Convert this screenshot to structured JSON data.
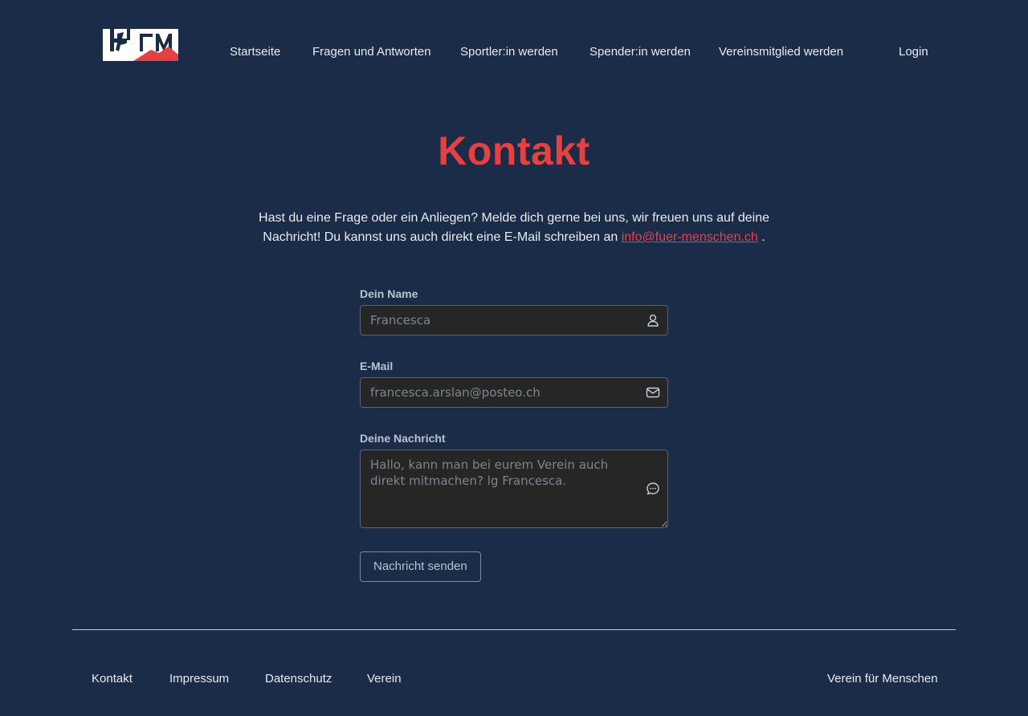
{
  "header": {
    "logo_alt": "HFM",
    "nav": [
      {
        "label": "Startseite"
      },
      {
        "label": "Fragen und Antworten"
      },
      {
        "label": "Sportler:in werden"
      },
      {
        "label": "Spender:in werden"
      },
      {
        "label": "Vereinsmitglied werden"
      }
    ],
    "login_label": "Login"
  },
  "main": {
    "title": "Kontakt",
    "intro_text": "Hast du eine Frage oder ein Anliegen? Melde dich gerne bei uns, wir freuen uns auf deine Nachricht! Du kannst uns auch direkt eine E-Mail schreiben an ",
    "intro_email": "info@fuer-menschen.ch",
    "intro_end": " ."
  },
  "form": {
    "name": {
      "label": "Dein Name",
      "placeholder": "Francesca",
      "icon": "user-icon"
    },
    "email": {
      "label": "E-Mail",
      "placeholder": "francesca.arslan@posteo.ch",
      "icon": "envelope-icon"
    },
    "message": {
      "label": "Deine Nachricht",
      "placeholder": "Hallo, kann man bei eurem Verein auch direkt mitmachen? lg Francesca.",
      "icon": "chat-bubble-icon"
    },
    "submit_label": "Nachricht senden"
  },
  "footer": {
    "links": [
      {
        "label": "Kontakt"
      },
      {
        "label": "Impressum"
      },
      {
        "label": "Datenschutz"
      },
      {
        "label": "Verein"
      }
    ],
    "brand": "Verein für Menschen"
  },
  "colors": {
    "background": "#1b2c48",
    "accent": "#e8403f",
    "input_bg": "#262626"
  }
}
